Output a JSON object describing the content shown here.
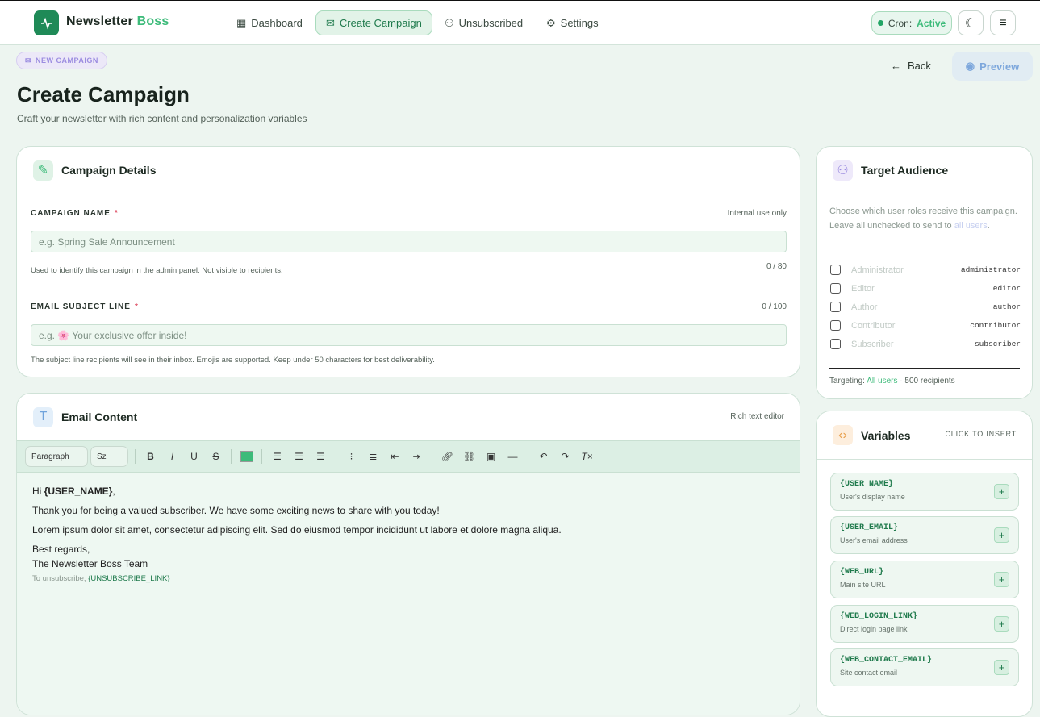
{
  "header": {
    "brand_a": "Newsletter",
    "brand_b": "Boss",
    "nav": [
      {
        "label": "Dashboard"
      },
      {
        "label": "Create Campaign"
      },
      {
        "label": "Unsubscribed"
      },
      {
        "label": "Settings"
      }
    ],
    "cron_label": "Cron:",
    "cron_status": "Active"
  },
  "page": {
    "badge": "NEW CAMPAIGN",
    "title": "Create Campaign",
    "subtitle": "Craft your newsletter with rich content and personalization variables",
    "back": "Back",
    "preview": "Preview"
  },
  "details": {
    "title": "Campaign Details",
    "name_label": "CAMPAIGN NAME",
    "req": "*",
    "name_note": "Internal use only",
    "name_placeholder": "e.g. Spring Sale Announcement",
    "name_help": "Used to identify this campaign in the admin panel. Not visible to recipients.",
    "name_count": "0 / 80",
    "subject_label": "EMAIL SUBJECT LINE",
    "subject_count": "0 / 100",
    "subject_placeholder": "e.g. 🌸 Your exclusive offer inside!",
    "subject_help": "The subject line recipients will see in their inbox. Emojis are supported. Keep under 50 characters for best deliverability."
  },
  "content": {
    "title": "Email Content",
    "note": "Rich text editor",
    "format": "Paragraph",
    "size": "Sz",
    "color": "#3dbb7a",
    "body": {
      "hi": "Hi ",
      "user_var": "{USER_NAME}",
      "comma": ",",
      "p1": "Thank you for being a valued subscriber. We have some exciting news to share with you today!",
      "p2": "Lorem ipsum dolor sit amet, consectetur adipiscing elit. Sed do eiusmod tempor incididunt ut labore et dolore magna aliqua.",
      "regards": "Best regards,",
      "team": "The Newsletter Boss Team",
      "unsub": "To unsubscribe, ",
      "unsub_link": "{UNSUBSCRIBE_LINK}"
    }
  },
  "audience": {
    "title": "Target Audience",
    "desc": "Choose which user roles receive this campaign. Leave all unchecked to send to ",
    "desc_link": "all users",
    "desc_end": ".",
    "roles": [
      {
        "name": "Administrator",
        "key": "administrator"
      },
      {
        "name": "Editor",
        "key": "editor"
      },
      {
        "name": "Author",
        "key": "author"
      },
      {
        "name": "Contributor",
        "key": "contributor"
      },
      {
        "name": "Subscriber",
        "key": "subscriber"
      }
    ],
    "targeting_label": "Targeting: ",
    "targeting_value": "All users",
    "sep": " · ",
    "recipients": "500 recipients"
  },
  "variables": {
    "title": "Variables",
    "hint": "CLICK TO INSERT",
    "items": [
      {
        "name": "{USER_NAME}",
        "desc": "User's display name"
      },
      {
        "name": "{USER_EMAIL}",
        "desc": "User's email address"
      },
      {
        "name": "{WEB_URL}",
        "desc": "Main site URL"
      },
      {
        "name": "{WEB_LOGIN_LINK}",
        "desc": "Direct login page link"
      },
      {
        "name": "{WEB_CONTACT_EMAIL}",
        "desc": "Site contact email"
      }
    ]
  }
}
